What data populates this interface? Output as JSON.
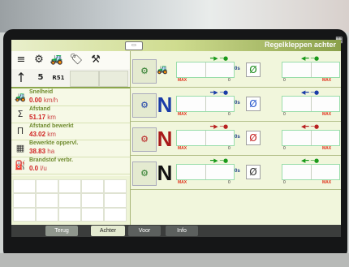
{
  "header": {
    "badge": "▭",
    "title": "Regelkleppen achter"
  },
  "icons": {
    "menu": "≡",
    "settings": "⚙",
    "tractor": "🚜",
    "tag": "🏷",
    "wrench_tool": "⚒",
    "arrow_up": "↑",
    "counter": "5",
    "indicator": "R51"
  },
  "info": [
    {
      "icon": "🚜",
      "label": "Snelheid",
      "value": "0.00",
      "unit": "km/h"
    },
    {
      "icon": "Σ",
      "label": "Afstand",
      "value": "51.17",
      "unit": "km"
    },
    {
      "icon": "Π",
      "label": "Afstand bewerkt",
      "value": "43.02",
      "unit": "km"
    },
    {
      "icon": "▦",
      "label": "Bewerkte oppervl.",
      "value": "38.83",
      "unit": "ha"
    },
    {
      "icon": "⛽",
      "label": "Brandstof verbr.",
      "value": "0.0",
      "unit": "l/u"
    }
  ],
  "valves": [
    {
      "letter": "",
      "letter_color": "#1a1a1a",
      "small": "🚜",
      "secs": "0s",
      "sym": "Ø",
      "sym_color": "#1a8a1a",
      "arrow_left": "━▶ ─●",
      "arrow_right": "◀━ ─●",
      "color": "#1a9a1a",
      "max": "MAX",
      "zero": "0",
      "max2": "MAX"
    },
    {
      "letter": "N",
      "letter_color": "#1a3ca8",
      "small": "",
      "secs": "0s",
      "sym": "Ø",
      "sym_color": "#2255cc",
      "arrow_left": "━▶ ─●",
      "arrow_right": "◀━ ─●",
      "color": "#1a3ca8",
      "max": "MAX",
      "zero": "0",
      "max2": "MAX"
    },
    {
      "letter": "N",
      "letter_color": "#a81a1a",
      "small": "",
      "secs": "0s",
      "sym": "Ø",
      "sym_color": "#c42020",
      "arrow_left": "━▶ ─●",
      "arrow_right": "◀━ ─●",
      "color": "#b82020",
      "max": "MAX",
      "zero": "0",
      "max2": "MAX"
    },
    {
      "letter": "N",
      "letter_color": "#111111",
      "small": "",
      "secs": "0s",
      "sym": "Ø",
      "sym_color": "#333333",
      "arrow_left": "━▶ ─●",
      "arrow_right": "◀━ ─●",
      "color": "#1a9a1a",
      "max": "MAX",
      "zero": "0",
      "max2": "MAX"
    }
  ],
  "tabs": {
    "back": "Terug",
    "rear": "Achter",
    "front": "Voor",
    "info": "Info"
  }
}
